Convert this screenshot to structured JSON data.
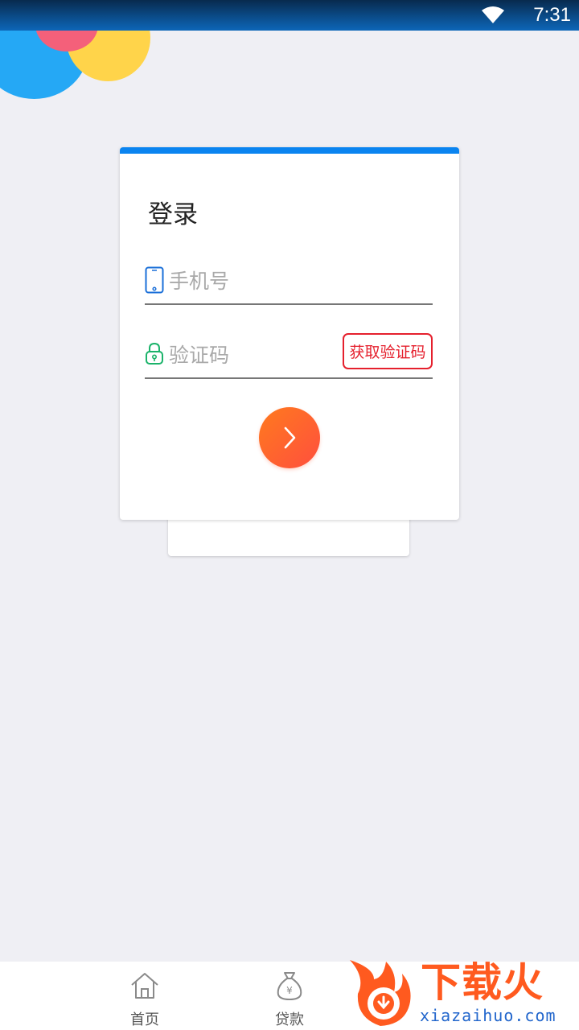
{
  "status_bar": {
    "time": "7:31",
    "wifi_icon": "wifi-icon"
  },
  "colors": {
    "accent_blue": "#0a84f0",
    "button_orange": "#ff6a2a",
    "code_button_red": "#e5202d",
    "background": "#efeff4"
  },
  "login": {
    "title": "登录",
    "phone": {
      "icon": "phone-icon",
      "placeholder": "手机号",
      "value": ""
    },
    "code": {
      "icon": "lock-icon",
      "placeholder": "验证码",
      "value": "",
      "get_code_label": "获取验证码"
    },
    "submit_icon": "chevron-right-icon"
  },
  "bottom_nav": {
    "items": [
      {
        "icon": "home-icon",
        "label": "首页"
      },
      {
        "icon": "money-bag-icon",
        "label": "贷款"
      }
    ]
  },
  "watermark": {
    "title": "下载火",
    "url": "xiazaihuo.com"
  }
}
